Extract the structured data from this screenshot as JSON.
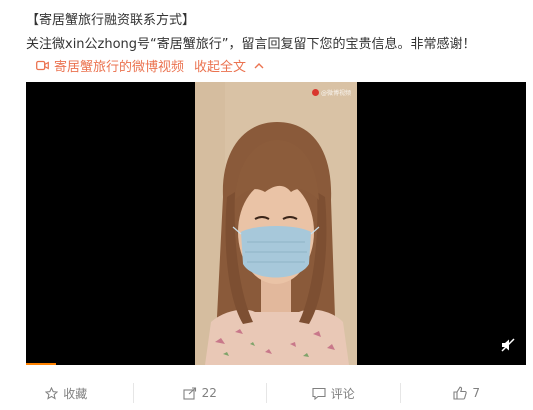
{
  "post": {
    "title": "【寄居蟹旅行融资联系方式】",
    "body": "关注微xin公zhong号“寄居蟹旅行”，留言回复留下您的宝贵信息。非常感谢！"
  },
  "video_link": {
    "icon": "video-camera-icon",
    "label": "寄居蟹旅行的微博视频",
    "collapse_label": "收起全文",
    "collapse_icon": "chevron-up-icon",
    "color": "#eb7350"
  },
  "video": {
    "watermark": "@微博视频",
    "progress": 0.06,
    "progress_color": "#ff8200",
    "mute_icon": "muted-speaker-icon"
  },
  "actions": [
    {
      "icon": "star-icon",
      "label": "收藏"
    },
    {
      "icon": "share-icon",
      "label": "22"
    },
    {
      "icon": "comment-icon",
      "label": "评论"
    },
    {
      "icon": "thumbs-up-icon",
      "label": "7"
    }
  ]
}
